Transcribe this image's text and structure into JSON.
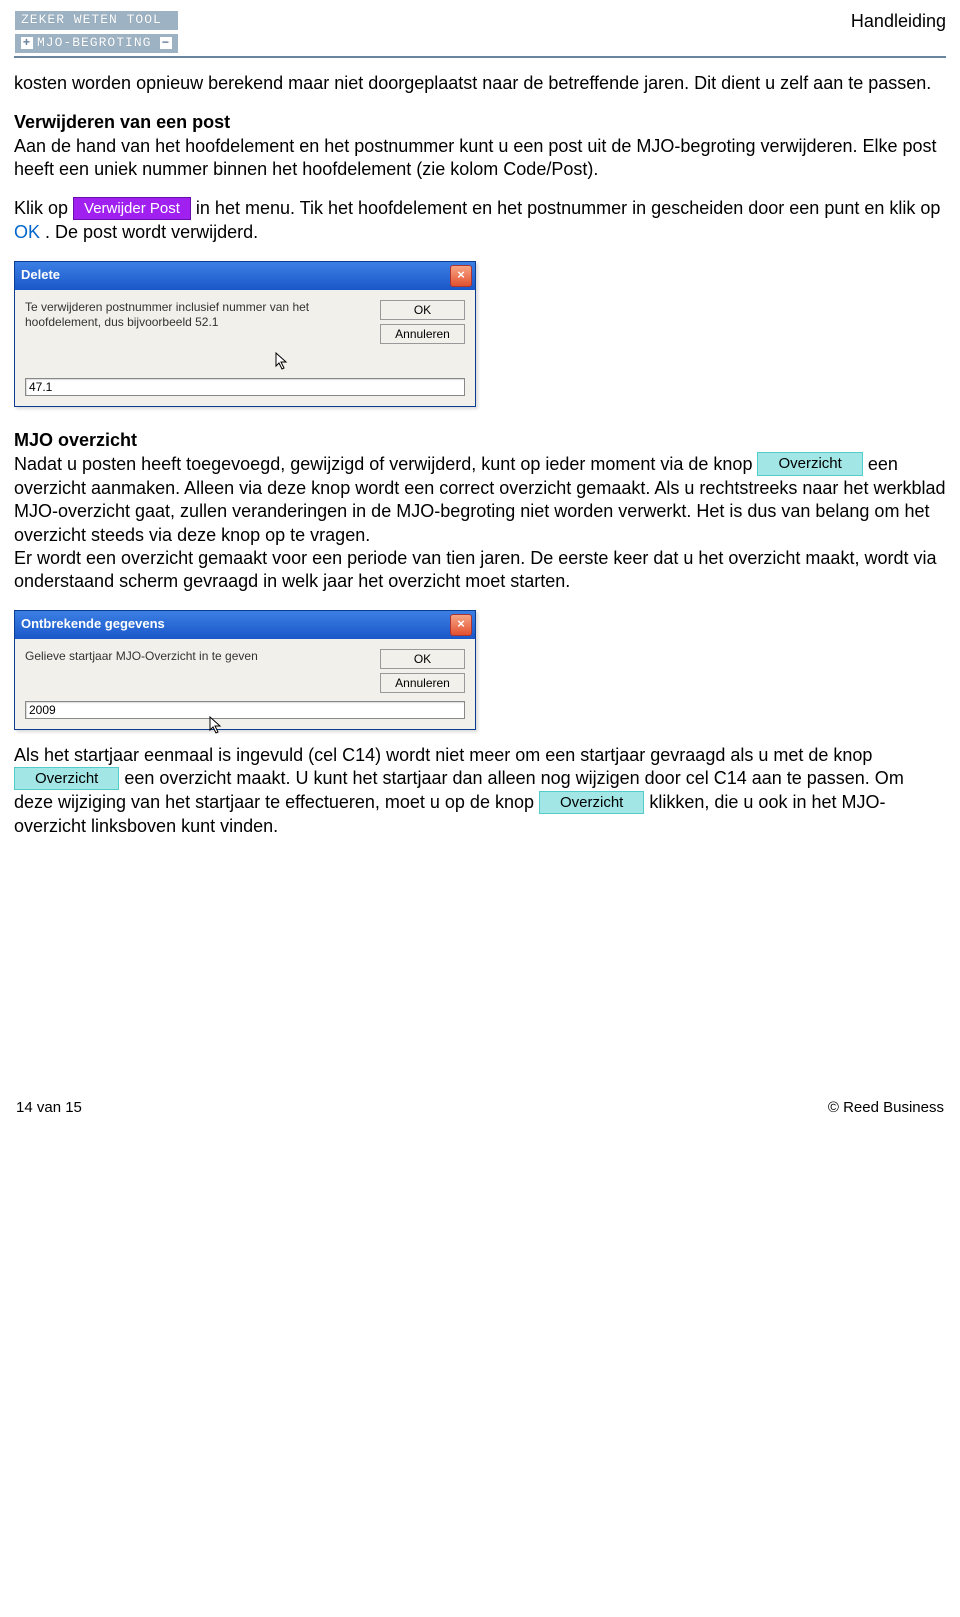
{
  "header": {
    "tool_label": "ZEKER WETEN TOOL",
    "nav_label": "MJO-BEGROTING",
    "right": "Handleiding"
  },
  "p1": "kosten worden opnieuw berekend maar niet doorgeplaatst naar de betreffende jaren. Dit dient u zelf aan te passen.",
  "remove": {
    "title": "Verwijderen van een post",
    "body": "Aan de hand van het hoofdelement en het postnummer kunt u een post uit de MJO-begroting verwijderen. Elke post heeft een uniek nummer binnen het hoofdelement (zie kolom Code/Post)."
  },
  "klik": {
    "pre": "Klik op ",
    "btn": "Verwijder Post",
    "mid": " in het menu. Tik het hoofdelement en het postnummer in gescheiden door een punt en klik op ",
    "ok": "OK",
    "post": ". De post wordt verwijderd."
  },
  "dialog1": {
    "title": "Delete",
    "text": "Te verwijderen postnummer inclusief nummer van het hoofdelement, dus bijvoorbeeld 52.1",
    "ok": "OK",
    "cancel": "Annuleren",
    "input": "47.1"
  },
  "mjo": {
    "title": "MJO overzicht",
    "p1a": "Nadat u posten heeft toegevoegd, gewijzigd of verwijderd, kunt op ieder moment via de knop ",
    "btn": "Overzicht",
    "p1b": " een overzicht aanmaken. Alleen via deze knop wordt een correct overzicht gemaakt. Als u rechtstreeks naar het werkblad MJO-overzicht gaat, zullen veranderingen in de MJO-begroting niet worden verwerkt. Het is dus van belang om het overzicht steeds via deze knop op te vragen.",
    "p1c": "Er wordt een overzicht gemaakt voor een periode van tien jaren. De eerste keer dat u het overzicht maakt, wordt via onderstaand scherm gevraagd in welk jaar het overzicht moet starten."
  },
  "dialog2": {
    "title": "Ontbrekende gegevens",
    "text": "Gelieve startjaar MJO-Overzicht in te geven",
    "ok": "OK",
    "cancel": "Annuleren",
    "input": "2009"
  },
  "tail": {
    "a": "Als het startjaar eenmaal is ingevuld (cel C14) wordt niet meer om een startjaar gevraagd als u met de knop ",
    "btn1": "Overzicht",
    "b": " een overzicht maakt. U kunt het startjaar dan alleen nog wijzigen door cel C14 aan te passen. Om deze wijziging van het startjaar te effectueren, moet u op de knop ",
    "btn2": "Overzicht",
    "c": " klikken, die u ook in het MJO-overzicht linksboven kunt vinden."
  },
  "footer": {
    "left": "14 van 15",
    "right": "© Reed Business"
  }
}
